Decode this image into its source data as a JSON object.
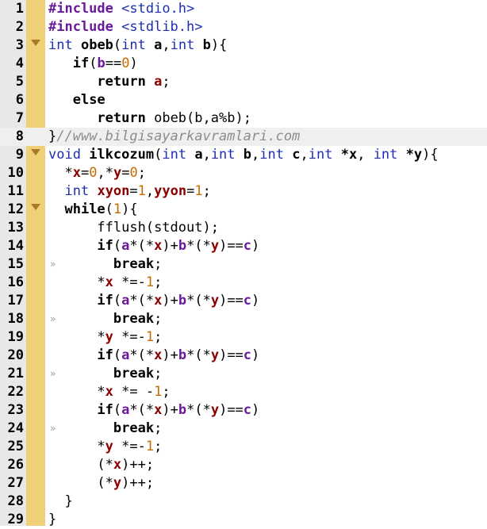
{
  "editor": {
    "current_line": 8,
    "lines": [
      {
        "n": "1",
        "tokens": [
          [
            "p",
            "#include"
          ],
          [
            "k",
            " "
          ],
          [
            "s",
            "<stdio.h>"
          ]
        ]
      },
      {
        "n": "2",
        "tokens": [
          [
            "p",
            "#include"
          ],
          [
            "k",
            " "
          ],
          [
            "s",
            "<stdlib.h>"
          ]
        ]
      },
      {
        "n": "3",
        "fold": true,
        "tokens": [
          [
            "kw",
            "int"
          ],
          [
            "k",
            " "
          ],
          [
            "b",
            "obeb"
          ],
          [
            "k",
            "("
          ],
          [
            "kw",
            "int"
          ],
          [
            "k",
            " "
          ],
          [
            "b",
            "a"
          ],
          [
            "k",
            ","
          ],
          [
            "kw",
            "int"
          ],
          [
            "k",
            " "
          ],
          [
            "b",
            "b"
          ],
          [
            "k",
            "){"
          ]
        ]
      },
      {
        "n": "4",
        "tokens": [
          [
            "k",
            "   "
          ],
          [
            "b",
            "if"
          ],
          [
            "k",
            "("
          ],
          [
            "p",
            "b"
          ],
          [
            "k",
            "=="
          ],
          [
            "n",
            "0"
          ],
          [
            "k",
            ")"
          ]
        ]
      },
      {
        "n": "5",
        "tokens": [
          [
            "k",
            "      "
          ],
          [
            "b",
            "return"
          ],
          [
            "k",
            " "
          ],
          [
            "id",
            "a"
          ],
          [
            "k",
            ";"
          ]
        ]
      },
      {
        "n": "6",
        "tokens": [
          [
            "k",
            "   "
          ],
          [
            "b",
            "else"
          ]
        ]
      },
      {
        "n": "7",
        "tokens": [
          [
            "k",
            "      "
          ],
          [
            "b",
            "return"
          ],
          [
            "k",
            " "
          ],
          [
            "k",
            "obeb"
          ],
          [
            "k",
            "("
          ],
          [
            "k",
            "b,a"
          ],
          [
            "k",
            "%"
          ],
          [
            "k",
            "b);"
          ]
        ]
      },
      {
        "n": "8",
        "tokens": [
          [
            "k",
            "}"
          ],
          [
            "cm",
            "//www.bilgisayarkavramlari.com"
          ]
        ]
      },
      {
        "n": "9",
        "fold": true,
        "tokens": [
          [
            "kw",
            "void"
          ],
          [
            "k",
            " "
          ],
          [
            "b",
            "ilkcozum"
          ],
          [
            "k",
            "("
          ],
          [
            "kw",
            "int"
          ],
          [
            "k",
            " "
          ],
          [
            "b",
            "a"
          ],
          [
            "k",
            ","
          ],
          [
            "kw",
            "int"
          ],
          [
            "k",
            " "
          ],
          [
            "b",
            "b"
          ],
          [
            "k",
            ","
          ],
          [
            "kw",
            "int"
          ],
          [
            "k",
            " "
          ],
          [
            "b",
            "c"
          ],
          [
            "k",
            ","
          ],
          [
            "kw",
            "int"
          ],
          [
            "k",
            " "
          ],
          [
            "b",
            "*x"
          ],
          [
            "k",
            ", "
          ],
          [
            "kw",
            "int"
          ],
          [
            "k",
            " "
          ],
          [
            "b",
            "*y"
          ],
          [
            "k",
            "){"
          ]
        ]
      },
      {
        "n": "10",
        "tokens": [
          [
            "k",
            "  "
          ],
          [
            "k",
            "*"
          ],
          [
            "id",
            "x"
          ],
          [
            "k",
            "="
          ],
          [
            "n",
            "0"
          ],
          [
            "k",
            ",*"
          ],
          [
            "id",
            "y"
          ],
          [
            "k",
            "="
          ],
          [
            "n",
            "0"
          ],
          [
            "k",
            ";"
          ]
        ]
      },
      {
        "n": "11",
        "tokens": [
          [
            "k",
            "  "
          ],
          [
            "kw",
            "int"
          ],
          [
            "k",
            " "
          ],
          [
            "id",
            "xyon"
          ],
          [
            "k",
            "="
          ],
          [
            "n",
            "1"
          ],
          [
            "k",
            ","
          ],
          [
            "id",
            "yyon"
          ],
          [
            "k",
            "="
          ],
          [
            "n",
            "1"
          ],
          [
            "k",
            ";"
          ]
        ]
      },
      {
        "n": "12",
        "fold": true,
        "tokens": [
          [
            "k",
            "  "
          ],
          [
            "b",
            "while"
          ],
          [
            "k",
            "("
          ],
          [
            "n",
            "1"
          ],
          [
            "k",
            "){"
          ]
        ]
      },
      {
        "n": "13",
        "tokens": [
          [
            "k",
            "      "
          ],
          [
            "k",
            "fflush(stdout);"
          ]
        ]
      },
      {
        "n": "14",
        "tokens": [
          [
            "k",
            "      "
          ],
          [
            "b",
            "if"
          ],
          [
            "k",
            "("
          ],
          [
            "p",
            "a"
          ],
          [
            "k",
            "*(*"
          ],
          [
            "id",
            "x"
          ],
          [
            "k",
            ")+"
          ],
          [
            "p",
            "b"
          ],
          [
            "k",
            "*(*"
          ],
          [
            "id",
            "y"
          ],
          [
            "k",
            ")=="
          ],
          [
            "p",
            "c"
          ],
          [
            "k",
            ")"
          ]
        ]
      },
      {
        "n": "15",
        "wrap": true,
        "tokens": [
          [
            "k",
            "        "
          ],
          [
            "b",
            "break"
          ],
          [
            "k",
            ";"
          ]
        ]
      },
      {
        "n": "16",
        "tokens": [
          [
            "k",
            "      "
          ],
          [
            "k",
            "*"
          ],
          [
            "id",
            "x"
          ],
          [
            "k",
            " *=-"
          ],
          [
            "n",
            "1"
          ],
          [
            "k",
            ";"
          ]
        ]
      },
      {
        "n": "17",
        "tokens": [
          [
            "k",
            "      "
          ],
          [
            "b",
            "if"
          ],
          [
            "k",
            "("
          ],
          [
            "p",
            "a"
          ],
          [
            "k",
            "*(*"
          ],
          [
            "id",
            "x"
          ],
          [
            "k",
            ")+"
          ],
          [
            "p",
            "b"
          ],
          [
            "k",
            "*(*"
          ],
          [
            "id",
            "y"
          ],
          [
            "k",
            ")=="
          ],
          [
            "p",
            "c"
          ],
          [
            "k",
            ")"
          ]
        ]
      },
      {
        "n": "18",
        "wrap": true,
        "tokens": [
          [
            "k",
            "        "
          ],
          [
            "b",
            "break"
          ],
          [
            "k",
            ";"
          ]
        ]
      },
      {
        "n": "19",
        "tokens": [
          [
            "k",
            "      "
          ],
          [
            "k",
            "*"
          ],
          [
            "id",
            "y"
          ],
          [
            "k",
            " *=-"
          ],
          [
            "n",
            "1"
          ],
          [
            "k",
            ";"
          ]
        ]
      },
      {
        "n": "20",
        "tokens": [
          [
            "k",
            "      "
          ],
          [
            "b",
            "if"
          ],
          [
            "k",
            "("
          ],
          [
            "p",
            "a"
          ],
          [
            "k",
            "*(*"
          ],
          [
            "id",
            "x"
          ],
          [
            "k",
            ")+"
          ],
          [
            "p",
            "b"
          ],
          [
            "k",
            "*(*"
          ],
          [
            "id",
            "y"
          ],
          [
            "k",
            ")=="
          ],
          [
            "p",
            "c"
          ],
          [
            "k",
            ")"
          ]
        ]
      },
      {
        "n": "21",
        "wrap": true,
        "tokens": [
          [
            "k",
            "        "
          ],
          [
            "b",
            "break"
          ],
          [
            "k",
            ";"
          ]
        ]
      },
      {
        "n": "22",
        "tokens": [
          [
            "k",
            "      "
          ],
          [
            "k",
            "*"
          ],
          [
            "id",
            "x"
          ],
          [
            "k",
            " *= -"
          ],
          [
            "n",
            "1"
          ],
          [
            "k",
            ";"
          ]
        ]
      },
      {
        "n": "23",
        "tokens": [
          [
            "k",
            "      "
          ],
          [
            "b",
            "if"
          ],
          [
            "k",
            "("
          ],
          [
            "p",
            "a"
          ],
          [
            "k",
            "*(*"
          ],
          [
            "id",
            "x"
          ],
          [
            "k",
            ")+"
          ],
          [
            "p",
            "b"
          ],
          [
            "k",
            "*(*"
          ],
          [
            "id",
            "y"
          ],
          [
            "k",
            ")=="
          ],
          [
            "p",
            "c"
          ],
          [
            "k",
            ")"
          ]
        ]
      },
      {
        "n": "24",
        "wrap": true,
        "tokens": [
          [
            "k",
            "        "
          ],
          [
            "b",
            "break"
          ],
          [
            "k",
            ";"
          ]
        ]
      },
      {
        "n": "25",
        "tokens": [
          [
            "k",
            "      "
          ],
          [
            "k",
            "*"
          ],
          [
            "id",
            "y"
          ],
          [
            "k",
            " *=-"
          ],
          [
            "n",
            "1"
          ],
          [
            "k",
            ";"
          ]
        ]
      },
      {
        "n": "26",
        "tokens": [
          [
            "k",
            "      "
          ],
          [
            "k",
            "(*"
          ],
          [
            "id",
            "x"
          ],
          [
            "k",
            ")++;"
          ]
        ]
      },
      {
        "n": "27",
        "tokens": [
          [
            "k",
            "      "
          ],
          [
            "k",
            "(*"
          ],
          [
            "id",
            "y"
          ],
          [
            "k",
            ")++;"
          ]
        ]
      },
      {
        "n": "28",
        "tokens": [
          [
            "k",
            "  "
          ],
          [
            "k",
            "}"
          ]
        ]
      },
      {
        "n": "29",
        "tokens": [
          [
            "k",
            "}"
          ]
        ]
      }
    ]
  },
  "colors": {
    "gutter": "#e8e8e8",
    "fold_column": "#f0cf79",
    "keyword": "#1d2fb0",
    "preprocessor": "#6a1b9a",
    "number": "#c76a00",
    "identifier": "#8b0000",
    "comment": "#8c8c8c"
  },
  "icons": {
    "fold": "fold-triangle-icon",
    "wrap": "wrap-marker-icon"
  }
}
